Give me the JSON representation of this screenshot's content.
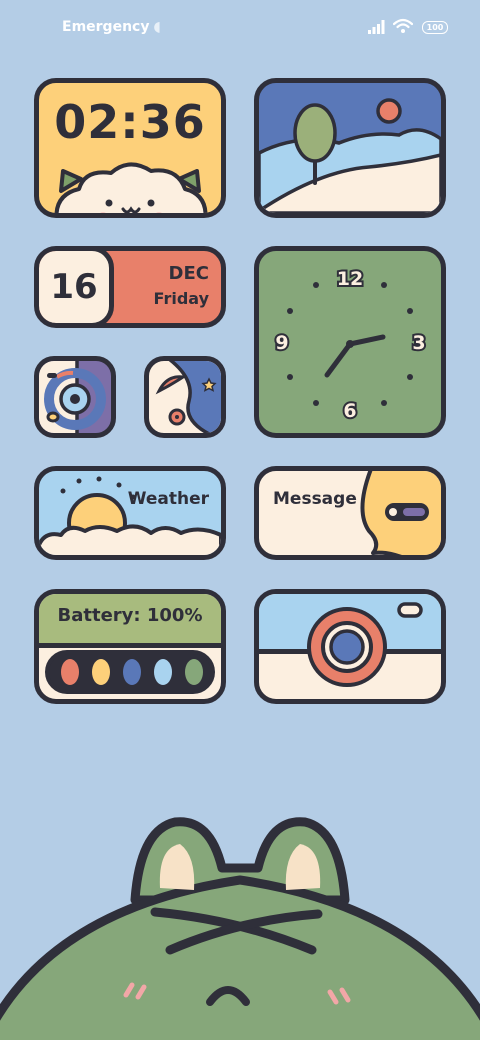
{
  "status_bar": {
    "carrier_text": "Emergency",
    "battery_level": "100",
    "signal_icon": "signal-bars-icon",
    "wifi_icon": "wifi-icon"
  },
  "clock_widget": {
    "time": "02:36"
  },
  "calendar_widget": {
    "day": "16",
    "month": "DEC",
    "weekday": "Friday"
  },
  "analog_clock": {
    "labels": [
      "12",
      "3",
      "6",
      "9"
    ]
  },
  "weather_widget": {
    "label": "Weather"
  },
  "message_widget": {
    "label": "Message"
  },
  "battery_widget": {
    "label": "Battery: 100%"
  },
  "colors": {
    "background": "#b4cde6",
    "outline": "#2f2f3a",
    "yellow": "#fdd07a",
    "green": "#86a77a",
    "orange": "#e8806a",
    "cream": "#fcefe0",
    "sky": "#a9d3ef",
    "navy": "#5a78b8"
  }
}
